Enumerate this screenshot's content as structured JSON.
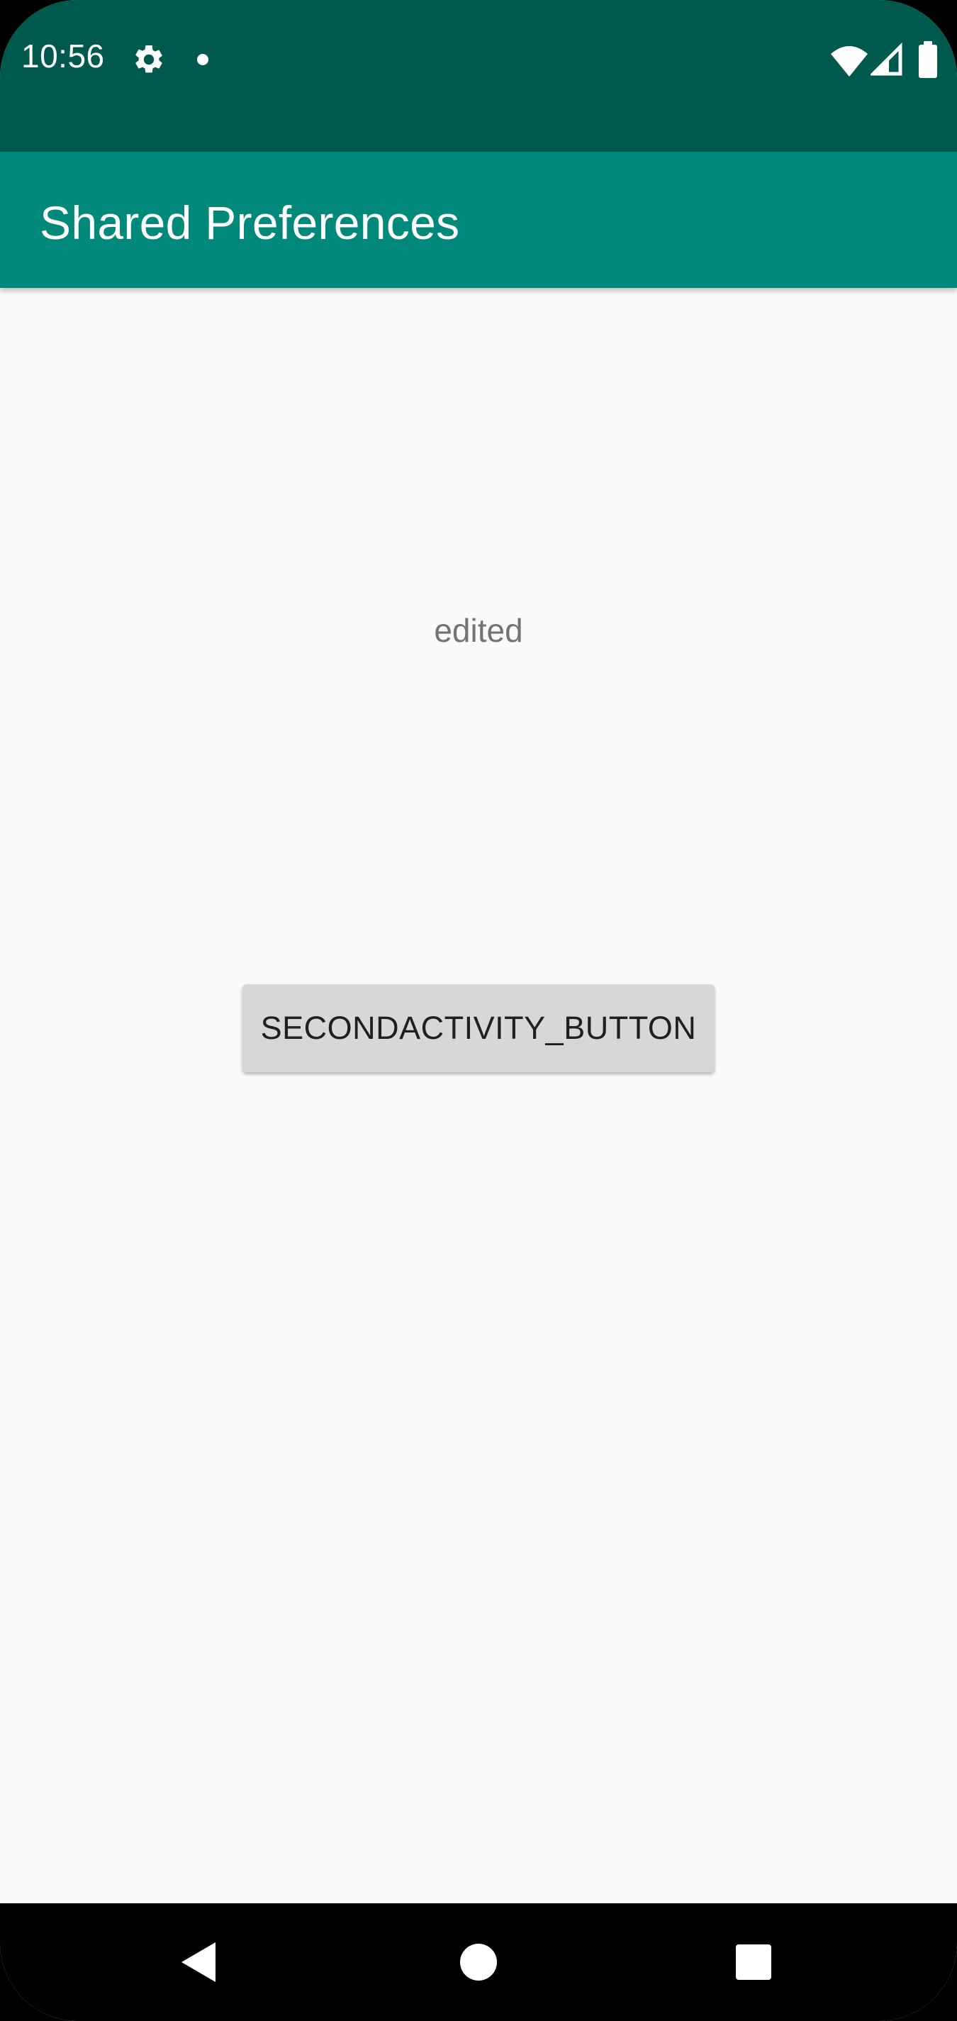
{
  "status_bar": {
    "time": "10:56",
    "icons": [
      "gear-icon",
      "notification-dot-icon",
      "wifi-icon",
      "cell-signal-icon",
      "battery-icon"
    ],
    "color": "#00594f"
  },
  "app_bar": {
    "title": "Shared Preferences",
    "color": "#00897b"
  },
  "main": {
    "label_text": "edited",
    "button_label": "SECONDACTIVITY_BUTTON"
  },
  "nav_bar": {
    "icons": [
      "back-icon",
      "home-icon",
      "recents-icon"
    ]
  }
}
